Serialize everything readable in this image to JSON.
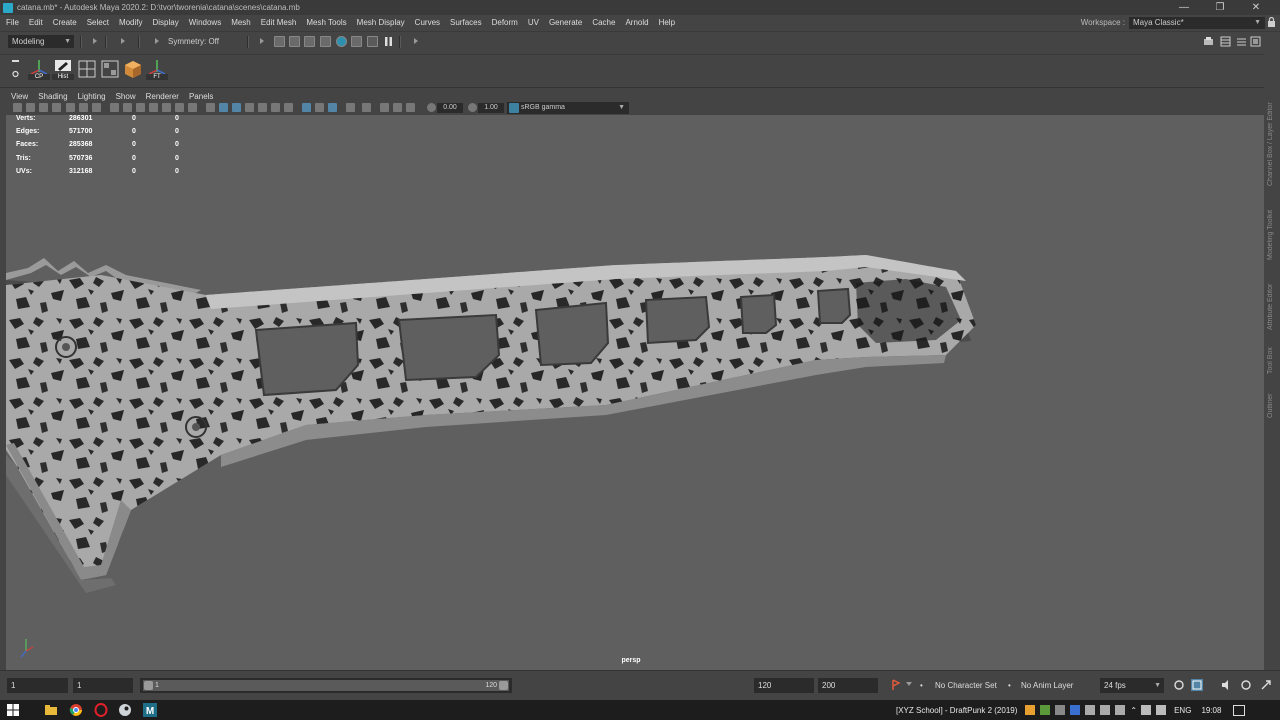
{
  "window": {
    "title": "catana.mb* - Autodesk Maya 2020.2: D:\\tvor\\tworenia\\catana\\scenes\\catana.mb",
    "controls": [
      "minimize-icon",
      "maximize-icon",
      "close-icon"
    ]
  },
  "menu": [
    "File",
    "Edit",
    "Create",
    "Select",
    "Modify",
    "Display",
    "Windows",
    "Mesh",
    "Edit Mesh",
    "Mesh Tools",
    "Mesh Display",
    "Curves",
    "Surfaces",
    "Deform",
    "UV",
    "Generate",
    "Cache",
    "Arnold",
    "Help"
  ],
  "workspace": {
    "label": "Workspace :",
    "value": "Maya Classic*"
  },
  "statusline": {
    "menuset": "Modeling",
    "symmetry": "Symmetry: Off"
  },
  "shelf": {
    "buttons": [
      {
        "label": "CP",
        "icon": "center-pivot-icon"
      },
      {
        "label": "Hist",
        "icon": "delete-history-icon"
      },
      {
        "label": "",
        "icon": "uv-grid-icon"
      },
      {
        "label": "",
        "icon": "uv-layout-icon"
      },
      {
        "label": "",
        "icon": "cube-icon"
      },
      {
        "label": "FT",
        "icon": "freeze-transform-icon"
      }
    ]
  },
  "panel": {
    "menus": [
      "View",
      "Shading",
      "Lighting",
      "Show",
      "Renderer",
      "Panels"
    ],
    "exposure": "0.00",
    "gamma": "1.00",
    "colorspace": "sRGB gamma"
  },
  "hud": {
    "rows": [
      {
        "label": "Verts:",
        "total": "286301",
        "selected": "0",
        "components": "0"
      },
      {
        "label": "Edges:",
        "total": "571700",
        "selected": "0",
        "components": "0"
      },
      {
        "label": "Faces:",
        "total": "285368",
        "selected": "0",
        "components": "0"
      },
      {
        "label": "Tris:",
        "total": "570736",
        "selected": "0",
        "components": "0"
      },
      {
        "label": "UVs:",
        "total": "312168",
        "selected": "0",
        "components": "0"
      }
    ]
  },
  "viewport": {
    "camera": "persp"
  },
  "side_tabs": [
    "Channel Box / Layer Editor",
    "Modeling Toolkit",
    "Attribute Editor",
    "Tool Box",
    "Outliner"
  ],
  "timeline": {
    "current_frame": "1",
    "range_start": "1",
    "slider_start": "1",
    "slider_end": "120",
    "range_end": "120",
    "anim_end": "200",
    "character_set": "No Character Set",
    "anim_layer": "No Anim Layer",
    "fps": "24 fps"
  },
  "taskbar": {
    "active_app": "[XYZ School] - DraftPunk 2 (2019)",
    "language": "ENG",
    "time": "19:08"
  },
  "colors": {
    "viewport_bg": "#5f5f5f",
    "ui_bg": "#444444",
    "field_bg": "#2b2b2b",
    "accent": "#5285a6",
    "taskbar": "#1d1d1d"
  }
}
